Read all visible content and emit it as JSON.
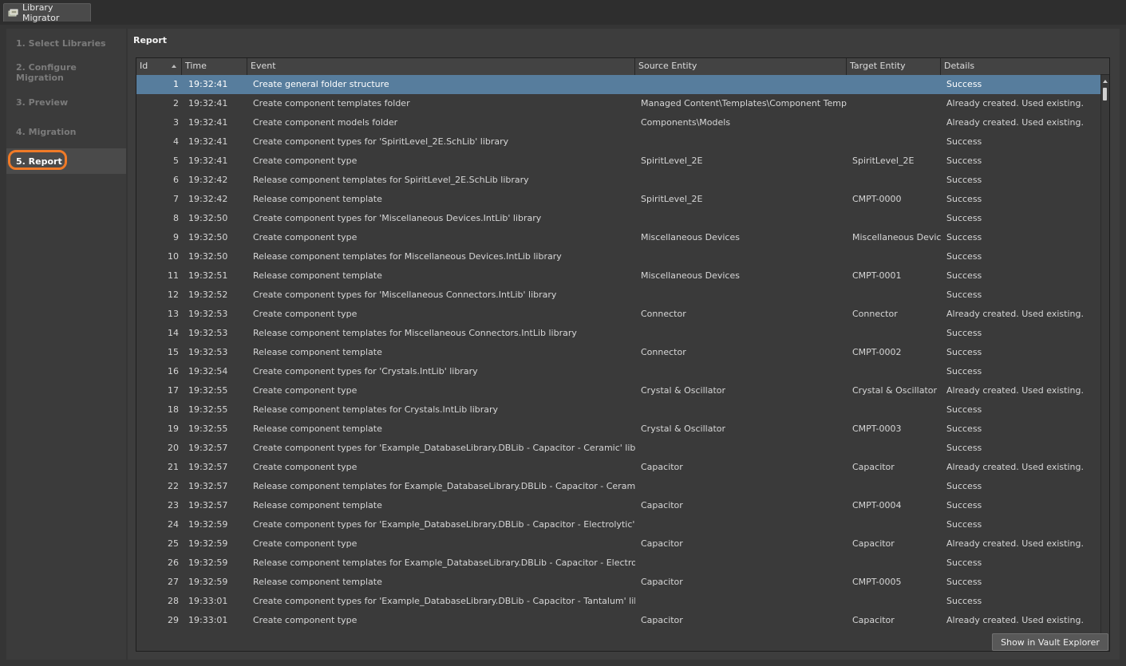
{
  "app": {
    "tab_title": "Library Migrator",
    "tab_icon": "library-migrator-icon"
  },
  "nav": {
    "items": [
      {
        "label": "1. Select Libraries",
        "active": false
      },
      {
        "label": "2. Configure Migration",
        "active": false
      },
      {
        "label": "3. Preview",
        "active": false
      },
      {
        "label": "4. Migration",
        "active": false
      },
      {
        "label": "5. Report",
        "active": true
      }
    ]
  },
  "report": {
    "title": "Report",
    "columns": [
      "Id",
      "Time",
      "Event",
      "Source Entity",
      "Target Entity",
      "Details"
    ],
    "sort_column": "Id",
    "sort_direction": "ascending",
    "selected_row_id": "1",
    "rows": [
      {
        "id": "1",
        "time": "19:32:41",
        "event": "Create general folder structure",
        "source": "",
        "target": "",
        "details": "Success"
      },
      {
        "id": "2",
        "time": "19:32:41",
        "event": "Create component templates folder",
        "source": "Managed Content\\Templates\\Component Templates",
        "target": "",
        "details": "Already created. Used existing."
      },
      {
        "id": "3",
        "time": "19:32:41",
        "event": "Create component models folder",
        "source": "Components\\Models",
        "target": "",
        "details": "Already created. Used existing."
      },
      {
        "id": "4",
        "time": "19:32:41",
        "event": "Create component types for 'SpiritLevel_2E.SchLib' library",
        "source": "",
        "target": "",
        "details": "Success"
      },
      {
        "id": "5",
        "time": "19:32:41",
        "event": "Create component type",
        "source": "SpiritLevel_2E",
        "target": "SpiritLevel_2E",
        "details": "Success"
      },
      {
        "id": "6",
        "time": "19:32:42",
        "event": "Release component templates for SpiritLevel_2E.SchLib library",
        "source": "",
        "target": "",
        "details": "Success"
      },
      {
        "id": "7",
        "time": "19:32:42",
        "event": "Release component template",
        "source": "SpiritLevel_2E",
        "target": "CMPT-0000",
        "details": "Success"
      },
      {
        "id": "8",
        "time": "19:32:50",
        "event": "Create component types for 'Miscellaneous Devices.IntLib' library",
        "source": "",
        "target": "",
        "details": "Success"
      },
      {
        "id": "9",
        "time": "19:32:50",
        "event": "Create component type",
        "source": "Miscellaneous Devices",
        "target": "Miscellaneous Devices",
        "details": "Success"
      },
      {
        "id": "10",
        "time": "19:32:50",
        "event": "Release component templates for Miscellaneous Devices.IntLib library",
        "source": "",
        "target": "",
        "details": "Success"
      },
      {
        "id": "11",
        "time": "19:32:51",
        "event": "Release component template",
        "source": "Miscellaneous Devices",
        "target": "CMPT-0001",
        "details": "Success"
      },
      {
        "id": "12",
        "time": "19:32:52",
        "event": "Create component types for 'Miscellaneous Connectors.IntLib' library",
        "source": "",
        "target": "",
        "details": "Success"
      },
      {
        "id": "13",
        "time": "19:32:53",
        "event": "Create component type",
        "source": "Connector",
        "target": "Connector",
        "details": "Already created. Used existing."
      },
      {
        "id": "14",
        "time": "19:32:53",
        "event": "Release component templates for Miscellaneous Connectors.IntLib library",
        "source": "",
        "target": "",
        "details": "Success"
      },
      {
        "id": "15",
        "time": "19:32:53",
        "event": "Release component template",
        "source": "Connector",
        "target": "CMPT-0002",
        "details": "Success"
      },
      {
        "id": "16",
        "time": "19:32:54",
        "event": "Create component types for 'Crystals.IntLib' library",
        "source": "",
        "target": "",
        "details": "Success"
      },
      {
        "id": "17",
        "time": "19:32:55",
        "event": "Create component type",
        "source": "Crystal & Oscillator",
        "target": "Crystal & Oscillator",
        "details": "Already created. Used existing."
      },
      {
        "id": "18",
        "time": "19:32:55",
        "event": "Release component templates for Crystals.IntLib library",
        "source": "",
        "target": "",
        "details": "Success"
      },
      {
        "id": "19",
        "time": "19:32:55",
        "event": "Release component template",
        "source": "Crystal & Oscillator",
        "target": "CMPT-0003",
        "details": "Success"
      },
      {
        "id": "20",
        "time": "19:32:57",
        "event": "Create component types for 'Example_DatabaseLibrary.DBLib - Capacitor - Ceramic' library",
        "source": "",
        "target": "",
        "details": "Success"
      },
      {
        "id": "21",
        "time": "19:32:57",
        "event": "Create component type",
        "source": "Capacitor",
        "target": "Capacitor",
        "details": "Already created. Used existing."
      },
      {
        "id": "22",
        "time": "19:32:57",
        "event": "Release component templates for Example_DatabaseLibrary.DBLib - Capacitor - Ceramic library",
        "source": "",
        "target": "",
        "details": "Success"
      },
      {
        "id": "23",
        "time": "19:32:57",
        "event": "Release component template",
        "source": "Capacitor",
        "target": "CMPT-0004",
        "details": "Success"
      },
      {
        "id": "24",
        "time": "19:32:59",
        "event": "Create component types for 'Example_DatabaseLibrary.DBLib - Capacitor - Electrolytic' library",
        "source": "",
        "target": "",
        "details": "Success"
      },
      {
        "id": "25",
        "time": "19:32:59",
        "event": "Create component type",
        "source": "Capacitor",
        "target": "Capacitor",
        "details": "Already created. Used existing."
      },
      {
        "id": "26",
        "time": "19:32:59",
        "event": "Release component templates for Example_DatabaseLibrary.DBLib - Capacitor - Electrolytic library",
        "source": "",
        "target": "",
        "details": "Success"
      },
      {
        "id": "27",
        "time": "19:32:59",
        "event": "Release component template",
        "source": "Capacitor",
        "target": "CMPT-0005",
        "details": "Success"
      },
      {
        "id": "28",
        "time": "19:33:01",
        "event": "Create component types for 'Example_DatabaseLibrary.DBLib - Capacitor - Tantalum' library",
        "source": "",
        "target": "",
        "details": "Success"
      },
      {
        "id": "29",
        "time": "19:33:01",
        "event": "Create component type",
        "source": "Capacitor",
        "target": "Capacitor",
        "details": "Already created. Used existing."
      }
    ]
  },
  "buttons": {
    "show_in_vault_explorer": "Show in Vault Explorer"
  },
  "colors": {
    "selection": "#577d9d",
    "active_highlight": "#f07a27"
  }
}
